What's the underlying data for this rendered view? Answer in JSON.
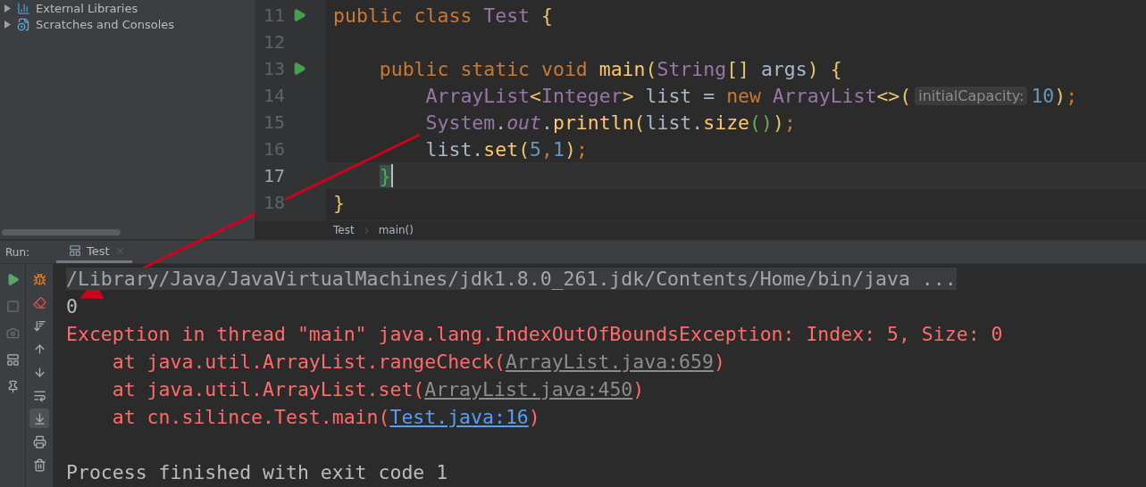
{
  "project_tree": {
    "items": [
      {
        "label": "External Libraries",
        "expanded": false
      },
      {
        "label": "Scratches and Consoles",
        "expanded": false
      }
    ]
  },
  "editor": {
    "lines": [
      {
        "number": "11",
        "run_marker": true,
        "current": false,
        "tokens": [
          {
            "text": "public class ",
            "kind": "kw"
          },
          {
            "text": "Test",
            "kind": "cls"
          },
          {
            "text": " {",
            "kind": "brace"
          }
        ]
      },
      {
        "number": "12",
        "run_marker": false,
        "current": false
      },
      {
        "number": "13",
        "run_marker": true,
        "current": false,
        "tokens": [
          {
            "text": "    public static void ",
            "kind": "kw"
          },
          {
            "text": "main",
            "kind": "fn"
          },
          {
            "text": "(",
            "kind": "brace"
          },
          {
            "text": "String",
            "kind": "cls"
          },
          {
            "text": "[] ",
            "kind": "brace"
          },
          {
            "text": "args",
            "kind": "plain"
          },
          {
            "text": ") {",
            "kind": "brace"
          }
        ]
      },
      {
        "number": "14",
        "run_marker": false,
        "current": false,
        "tokens": [
          {
            "text": "        ArrayList",
            "kind": "cls"
          },
          {
            "text": "<",
            "kind": "brace"
          },
          {
            "text": "Integer",
            "kind": "cls"
          },
          {
            "text": "> ",
            "kind": "brace"
          },
          {
            "text": "list = ",
            "kind": "plain"
          },
          {
            "text": "new ",
            "kind": "kw"
          },
          {
            "text": "ArrayList",
            "kind": "cls"
          },
          {
            "text": "<>(",
            "kind": "brace"
          },
          {
            "text": "initialCapacity:",
            "kind": "hint"
          },
          {
            "text": "10",
            "kind": "num"
          },
          {
            "text": ")",
            "kind": "brace"
          },
          {
            "text": ";",
            "kind": "kw"
          }
        ]
      },
      {
        "number": "15",
        "run_marker": false,
        "current": false,
        "tokens": [
          {
            "text": "        System",
            "kind": "cls"
          },
          {
            "text": ".",
            "kind": "plain"
          },
          {
            "text": "out",
            "kind": "field"
          },
          {
            "text": ".",
            "kind": "plain"
          },
          {
            "text": "println",
            "kind": "fn"
          },
          {
            "text": "(",
            "kind": "brace"
          },
          {
            "text": "list.",
            "kind": "plain"
          },
          {
            "text": "size",
            "kind": "fn"
          },
          {
            "text": "()",
            "kind": "paren2"
          },
          {
            "text": ")",
            "kind": "brace"
          },
          {
            "text": ";",
            "kind": "kw"
          }
        ]
      },
      {
        "number": "16",
        "run_marker": false,
        "current": false,
        "tokens": [
          {
            "text": "        list.",
            "kind": "plain"
          },
          {
            "text": "set",
            "kind": "fn"
          },
          {
            "text": "(",
            "kind": "brace"
          },
          {
            "text": "5",
            "kind": "num"
          },
          {
            "text": ",",
            "kind": "kw"
          },
          {
            "text": "1",
            "kind": "num"
          },
          {
            "text": ")",
            "kind": "brace"
          },
          {
            "text": ";",
            "kind": "kw"
          }
        ]
      },
      {
        "number": "17",
        "run_marker": false,
        "current": true,
        "tokens": [
          {
            "text": "    }",
            "kind": "match"
          }
        ]
      },
      {
        "number": "18",
        "run_marker": false,
        "current": false,
        "tokens": [
          {
            "text": "}",
            "kind": "brace"
          }
        ]
      }
    ],
    "breadcrumbs": [
      "Test",
      "main()"
    ]
  },
  "run_panel": {
    "label": "Run:",
    "tabs": [
      {
        "label": "Test",
        "selected": true
      }
    ],
    "left_tools": [
      {
        "enabled": true
      },
      {
        "enabled": false
      },
      {
        "enabled": false
      },
      {
        "enabled": true
      },
      {
        "enabled": true
      }
    ],
    "tools": [
      {
        "active": false
      },
      {
        "active": false
      },
      {
        "active": false
      },
      {
        "active": false
      },
      {
        "active": false
      },
      {
        "active": false
      },
      {
        "active": true
      },
      {
        "active": false
      },
      {
        "active": false
      }
    ],
    "console": [
      {
        "kind": "command",
        "text": "/Library/Java/JavaVirtualMachines/jdk1.8.0_261.jdk/Contents/Home/bin/java ..."
      },
      {
        "kind": "output",
        "text": "0"
      },
      {
        "kind": "error",
        "text": "Exception in thread \"main\" java.lang.IndexOutOfBoundsException: Index: 5, Size: 0"
      },
      {
        "kind": "stack",
        "text": "    at java.util.ArrayList.rangeCheck(",
        "link": "ArrayList.java:659",
        "own_code": false,
        "suffix": ")"
      },
      {
        "kind": "stack",
        "text": "    at java.util.ArrayList.set(",
        "link": "ArrayList.java:450",
        "own_code": false,
        "suffix": ")"
      },
      {
        "kind": "stack",
        "text": "    at cn.silince.Test.main(",
        "link": "Test.java:16",
        "own_code": true,
        "suffix": ")"
      },
      {
        "kind": "blank"
      },
      {
        "kind": "output",
        "text": "Process finished with exit code 1"
      }
    ]
  }
}
